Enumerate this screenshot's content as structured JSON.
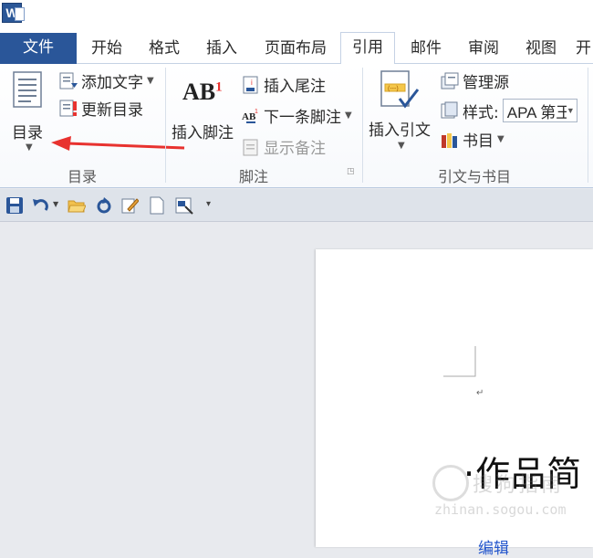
{
  "app": {
    "icon_letter": "W"
  },
  "tabs": [
    "文件",
    "开始",
    "格式",
    "插入",
    "页面布局",
    "引用",
    "邮件",
    "审阅",
    "视图",
    "开"
  ],
  "ribbon": {
    "toc": {
      "big_label": "目录",
      "add_text": "添加文字",
      "update_toc": "更新目录",
      "group": "目录"
    },
    "footnote": {
      "big_label": "插入脚注",
      "insert_endnote": "插入尾注",
      "next_footnote": "下一条脚注",
      "show_notes": "显示备注",
      "group": "脚注",
      "icon_text": "AB",
      "icon_sup": "1"
    },
    "citation": {
      "big_label": "插入引文",
      "manage_sources": "管理源",
      "style_label": "样式:",
      "style_value": "APA 第王",
      "bibliography": "书目",
      "group": "引文与书目"
    }
  },
  "document": {
    "heading": "·作品简",
    "edit_link": "编辑",
    "paragraph_mark": "↵"
  },
  "watermark": {
    "text": "搜狗指南",
    "sub": "zhinan.sogou.com"
  },
  "colors": {
    "file_tab": "#2a5699",
    "arrow": "#e8322f",
    "link": "#2255cc"
  }
}
